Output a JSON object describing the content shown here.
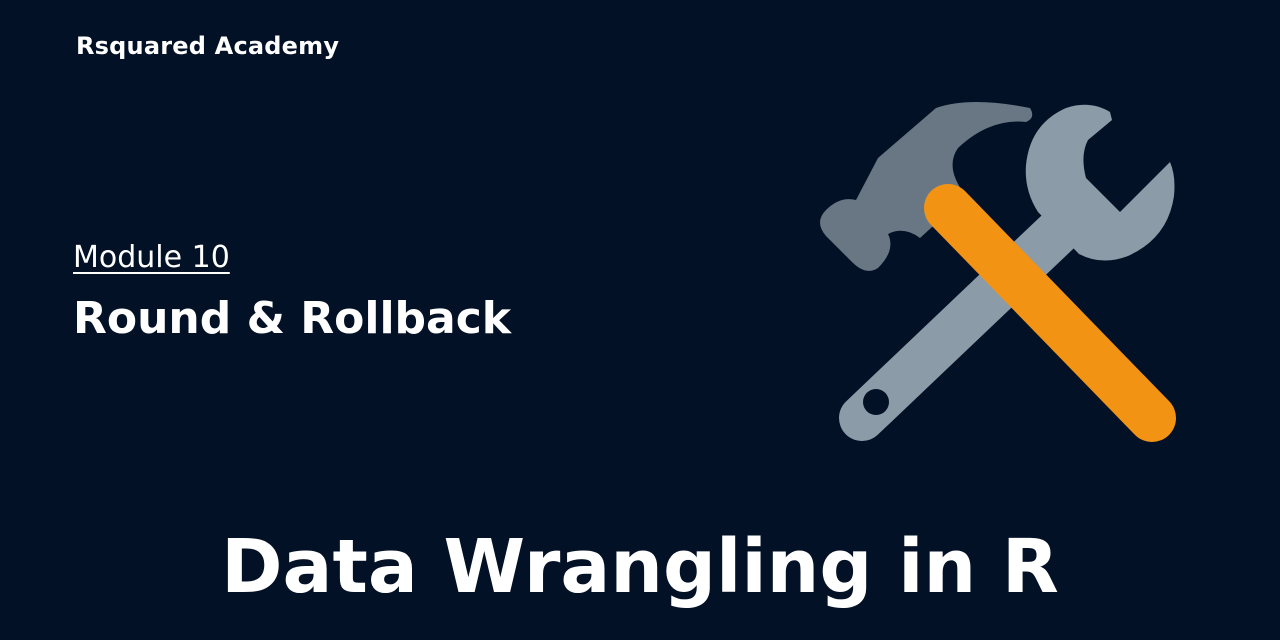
{
  "header": {
    "brand": "Rsquared Academy"
  },
  "content": {
    "module_label": "Module 10",
    "lesson_title": "Round & Rollback",
    "course_title": "Data Wrangling in R"
  },
  "illustration": {
    "icon": "hammer-and-wrench-icon",
    "colors": {
      "background": "#031126",
      "hammer_head": "#697784",
      "hammer_handle": "#f39314",
      "wrench": "#8b9ba8"
    }
  }
}
